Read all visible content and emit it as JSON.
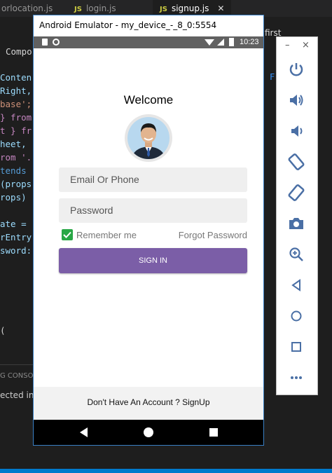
{
  "editor": {
    "tabs": [
      {
        "name": "orlocation.js",
        "icon": "none",
        "active": false
      },
      {
        "name": "login.js",
        "icon": "JS",
        "active": false
      },
      {
        "name": "signup.js",
        "icon": "JS",
        "active": true
      }
    ],
    "close_glyph": "✕",
    "breadcrumb_fragment": "first",
    "code_lines": [
      {
        "text": "Compo",
        "color": "#d4d4d4"
      },
      {
        "text": "Conten",
        "color": "#9cdcfe"
      },
      {
        "text": "Right,",
        "color": "#9cdcfe"
      },
      {
        "text": "base';",
        "color": "#ce9178"
      },
      {
        "text": "} from",
        "color": "#c586c0"
      },
      {
        "text": "t } fr",
        "color": "#c586c0"
      },
      {
        "text": "heet,",
        "color": "#9cdcfe"
      },
      {
        "text": "rom '.",
        "color": "#c586c0"
      },
      {
        "text": "tends",
        "color": "#569cd6"
      },
      {
        "text": "(props",
        "color": "#9cdcfe"
      },
      {
        "text": "rops)",
        "color": "#9cdcfe"
      },
      {
        "text": "ate =",
        "color": "#9cdcfe"
      },
      {
        "text": "rEntry",
        "color": "#9cdcfe"
      },
      {
        "text": "sword:",
        "color": "#9cdcfe"
      },
      {
        "text": "(",
        "color": "#d4d4d4"
      }
    ],
    "right_fragment": "F",
    "panel_tab": "G CONSO",
    "panel_text": "ected in"
  },
  "emulator": {
    "title": "Android Emulator - my_device_-_8_0:5554",
    "status_time": "10:23",
    "app": {
      "welcome": "Welcome",
      "email_placeholder": "Email Or Phone",
      "password_placeholder": "Password",
      "remember_label": "Remember me",
      "remember_checked": true,
      "forgot_label": "Forgot Password",
      "signin_label": "SIGN IN",
      "footer_text": "Don't Have An Account ? SignUp"
    },
    "colors": {
      "accent": "#7b5ea7",
      "checkbox": "#28a745",
      "window_border": "#3a80c5"
    },
    "toolbar": {
      "minimize_glyph": "–",
      "close_glyph": "×",
      "buttons": [
        "power-icon",
        "volume-up-icon",
        "volume-down-icon",
        "rotate-left-icon",
        "rotate-right-icon",
        "camera-icon",
        "zoom-icon",
        "back-icon",
        "home-icon",
        "overview-icon",
        "more-icon"
      ]
    }
  }
}
